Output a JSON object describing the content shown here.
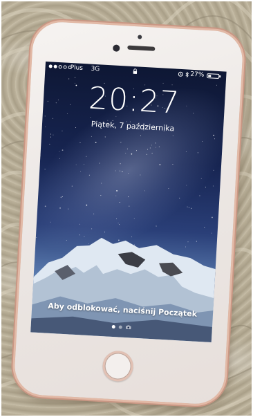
{
  "status_bar": {
    "carrier": "Plus",
    "network": "3G",
    "battery_text": "27%",
    "battery_level": 0.27,
    "signal_bars_filled": 2,
    "signal_bars_total": 5
  },
  "lock_screen": {
    "time": "20:27",
    "date": "Piątek, 7 października",
    "unlock_prompt": "Aby odblokować, naciśnij Początek"
  },
  "icons": {
    "lock": "lock-icon",
    "alarm": "alarm-icon",
    "bluetooth": "bluetooth-icon",
    "camera": "camera-icon"
  },
  "colors": {
    "phone_body": "#ece7e4",
    "rose_gold_edge": "#e2b9a6",
    "sky_top": "#0e1734",
    "sky_bottom": "#98b8d8"
  }
}
